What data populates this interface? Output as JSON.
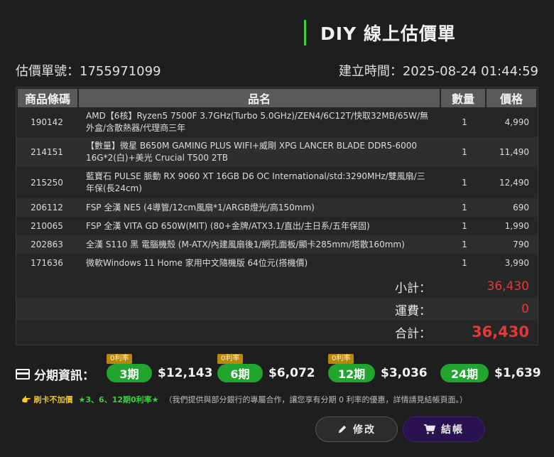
{
  "header": {
    "title": "DIY 線上估價單",
    "quote_no": "估價單號：1755971099",
    "created": "建立時間：2025-08-24 01:44:59"
  },
  "table": {
    "columns": [
      "商品條碼",
      "品名",
      "數量",
      "價格"
    ],
    "rows": [
      {
        "code": "190142",
        "name": "AMD【6核】Ryzen5 7500F 3.7GHz(Turbo 5.0GHz)/ZEN4/6C12T/快取32MB/65W/無外盒/含散熱器/代理商三年",
        "qty": "1",
        "price": "4,990"
      },
      {
        "code": "214151",
        "name": "【數量】微星 B650M GAMING PLUS WIFI+威剛 XPG LANCER BLADE DDR5-6000 16G*2(白)+美光 Crucial T500 2TB",
        "qty": "1",
        "price": "11,490"
      },
      {
        "code": "215250",
        "name": "藍寶石 PULSE 脈動 RX 9060 XT 16GB D6 OC International/std:3290MHz/雙風扇/三年保(長24cm)",
        "qty": "1",
        "price": "12,490"
      },
      {
        "code": "206112",
        "name": "FSP 全漢 NE5 (4導管/12cm風扇*1/ARGB燈光/高150mm)",
        "qty": "1",
        "price": "690"
      },
      {
        "code": "210065",
        "name": "FSP 全漢 VITA GD 650W(MIT) (80+金牌/ATX3.1/直出/主日系/五年保固)",
        "qty": "1",
        "price": "1,990"
      },
      {
        "code": "202863",
        "name": "全漢 S110 黑 電腦機殼 (M-ATX/內建風扇後1/網孔面板/顯卡285mm/塔散160mm)",
        "qty": "1",
        "price": "790"
      },
      {
        "code": "171636",
        "name": "微軟Windows 11 Home 家用中文隨機版 64位元(搭機價)",
        "qty": "1",
        "price": "3,990"
      }
    ],
    "subtotal_label": "小計：",
    "subtotal": "36,430",
    "shipping_label": "運費：",
    "shipping": "0",
    "total_label": "合計：",
    "total": "36,430"
  },
  "installment": {
    "title": "分期資訊：",
    "plans": [
      {
        "badge": "0利率",
        "term": "3期",
        "amount": "$12,143"
      },
      {
        "badge": "0利率",
        "term": "6期",
        "amount": "$6,072"
      },
      {
        "badge": "0利率",
        "term": "12期",
        "amount": "$3,036"
      },
      {
        "badge": "",
        "term": "24期",
        "amount": "$1,639"
      }
    ]
  },
  "note": {
    "card": "👉 刷卡不加價",
    "promo": "★3、6、12期0利率★",
    "detail": "（我們提供與部分銀行的專屬合作，讓您享有分期 0 利率的優惠，詳情請見結帳頁面。）"
  },
  "buttons": {
    "edit": "修改",
    "checkout": "結帳"
  },
  "colors": {
    "accent_green": "#22a52e",
    "total_red": "#e03a3a",
    "checkout_bg": "#2a1250"
  }
}
